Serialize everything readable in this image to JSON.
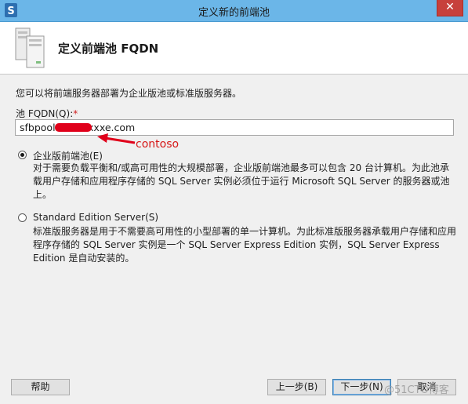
{
  "window": {
    "title": "定义新的前端池",
    "close_label": "✕"
  },
  "header": {
    "title": "定义前端池 FQDN"
  },
  "intro_text": "您可以将前端服务器部署为企业版池或标准版服务器。",
  "fqdn": {
    "label": "池 FQDN(Q):",
    "required_mark": "*",
    "value": "sfbpool.nxxxxxxxe.com",
    "value_visible_prefix": "sfbpool.n",
    "value_visible_suffix": "e.com"
  },
  "annotation": {
    "text": "contoso",
    "color": "#d61818"
  },
  "options": [
    {
      "label": "企业版前端池(E)",
      "selected": true,
      "description": "对于需要负载平衡和/或高可用性的大规模部署，企业版前端池最多可以包含 20 台计算机。为此池承载用户存储和应用程序存储的 SQL Server 实例必须位于运行 Microsoft SQL Server 的服务器或池上。"
    },
    {
      "label": "Standard Edition Server(S)",
      "selected": false,
      "description": "标准版服务器是用于不需要高可用性的小型部署的单一计算机。为此标准版服务器承载用户存储和应用程序存储的 SQL Server 实例是一个 SQL Server Express Edition 实例，SQL Server Express Edition 是自动安装的。"
    }
  ],
  "buttons": {
    "help": "帮助",
    "back": "上一步(B)",
    "next": "下一步(N)",
    "cancel": "取消"
  },
  "watermark": "@51CTO博客",
  "colors": {
    "titlebar": "#6bb6e8",
    "close": "#c7403b",
    "redaction": "#e0001a",
    "accent": "#3c7fb1"
  }
}
